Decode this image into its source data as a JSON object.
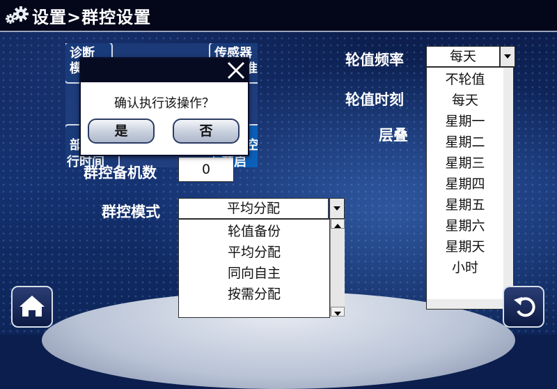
{
  "title": "设置>群控设置",
  "labels": {
    "rotation_freq": "轮值频率",
    "rotation_time": "轮值时刻",
    "floor_layer": "层叠",
    "standby_count": "群控备机数",
    "control_mode": "群控模式"
  },
  "tiles": {
    "diagnose": "诊断",
    "diagnose_line2": "模",
    "sensor": "传感器",
    "sensor_line2": "准",
    "left_mid": "部",
    "run_time": "行时间",
    "right_mid": "空",
    "turn_on": "开启"
  },
  "dialog": {
    "message": "确认执行该操作？",
    "yes": "是",
    "no": "否"
  },
  "standby_count_value": "0",
  "control_mode": {
    "selected": "平均分配",
    "options": [
      "轮值备份",
      "平均分配",
      "同向自主",
      "按需分配"
    ]
  },
  "rotation_freq": {
    "selected": "每天",
    "options": [
      "不轮值",
      "每天",
      "星期一",
      "星期二",
      "星期三",
      "星期四",
      "星期五",
      "星期六",
      "星期天",
      "小时"
    ]
  },
  "icons": {
    "title": "gear-icon",
    "home": "home-icon",
    "back": "back-icon",
    "close": "close-icon"
  }
}
